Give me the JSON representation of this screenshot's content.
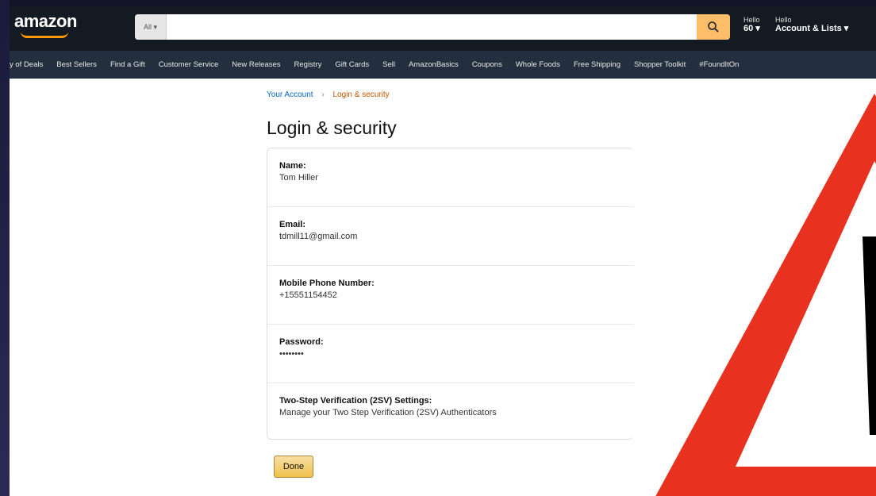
{
  "header": {
    "logo": "amazon",
    "search_category": "All ▾",
    "search_placeholder": "",
    "account_line1": "Hello",
    "account_line1b": "60 ▾",
    "account_line2_small": "Hello",
    "account_line2": "Account & Lists ▾"
  },
  "nav": {
    "items": [
      "y of Deals",
      "Best Sellers",
      "Find a Gift",
      "Customer Service",
      "New Releases",
      "Registry",
      "Gift Cards",
      "Sell",
      "AmazonBasics",
      "Coupons",
      "Whole Foods",
      "Free Shipping",
      "Shopper Toolkit",
      "#FoundItOn"
    ]
  },
  "breadcrumb": {
    "parent": "Your Account",
    "separator": "›",
    "current": "Login & security"
  },
  "page": {
    "title": "Login & security",
    "done_label": "Done"
  },
  "rows": [
    {
      "label": "Name:",
      "value": "Tom Hiller"
    },
    {
      "label": "Email:",
      "value": "tdmill11@gmail.com"
    },
    {
      "label": "Mobile Phone Number:",
      "value": "+15551154452"
    },
    {
      "label": "Password:",
      "value": "••••••••"
    },
    {
      "label": "Two-Step Verification (2SV) Settings:",
      "value": "Manage your Two Step Verification (2SV) Authenticators"
    }
  ],
  "colors": {
    "nav_dark": "#131a22",
    "nav_sub": "#232f3e",
    "search_button": "#febd69",
    "link": "#0066c0",
    "breadcrumb_current": "#c45500",
    "warning_red": "#e8321f",
    "done_button": "#f0c14b"
  },
  "icons": {
    "search": "search-icon",
    "warning": "warning-icon"
  }
}
